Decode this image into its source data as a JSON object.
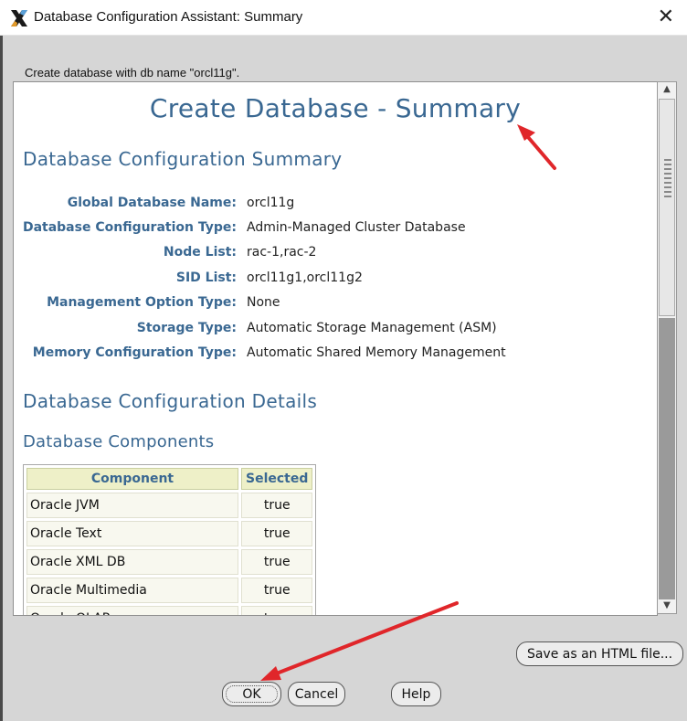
{
  "window": {
    "title": "Database Configuration Assistant: Summary",
    "close_label": "✕"
  },
  "message": "Create database with db name \"orcl11g\".",
  "summary": {
    "main_heading": "Create Database - Summary",
    "section1_heading": "Database Configuration Summary",
    "fields": [
      {
        "label": "Global Database Name:",
        "value": "orcl11g"
      },
      {
        "label": "Database Configuration Type:",
        "value": "Admin-Managed Cluster Database"
      },
      {
        "label": "Node List:",
        "value": "rac-1,rac-2"
      },
      {
        "label": "SID List:",
        "value": "orcl11g1,orcl11g2"
      },
      {
        "label": "Management Option Type:",
        "value": "None"
      },
      {
        "label": "Storage Type:",
        "value": "Automatic Storage Management (ASM)"
      },
      {
        "label": "Memory Configuration Type:",
        "value": "Automatic Shared Memory Management"
      }
    ],
    "section2_heading": "Database Configuration Details",
    "components_heading": "Database Components",
    "components_table": {
      "headers": [
        "Component",
        "Selected"
      ],
      "rows": [
        [
          "Oracle JVM",
          "true"
        ],
        [
          "Oracle Text",
          "true"
        ],
        [
          "Oracle XML DB",
          "true"
        ],
        [
          "Oracle Multimedia",
          "true"
        ],
        [
          "Oracle OLAP",
          "true"
        ]
      ]
    }
  },
  "buttons": {
    "save_html": "Save as an HTML file...",
    "ok": "OK",
    "cancel": "Cancel",
    "help": "Help"
  },
  "colors": {
    "heading_blue": "#3a6892",
    "annotation_arrow": "#e0262a"
  },
  "icons": {
    "app": "oracle-x-icon",
    "close": "close-icon",
    "scroll_up": "scroll-up-arrow-icon",
    "scroll_down": "scroll-down-arrow-icon"
  }
}
